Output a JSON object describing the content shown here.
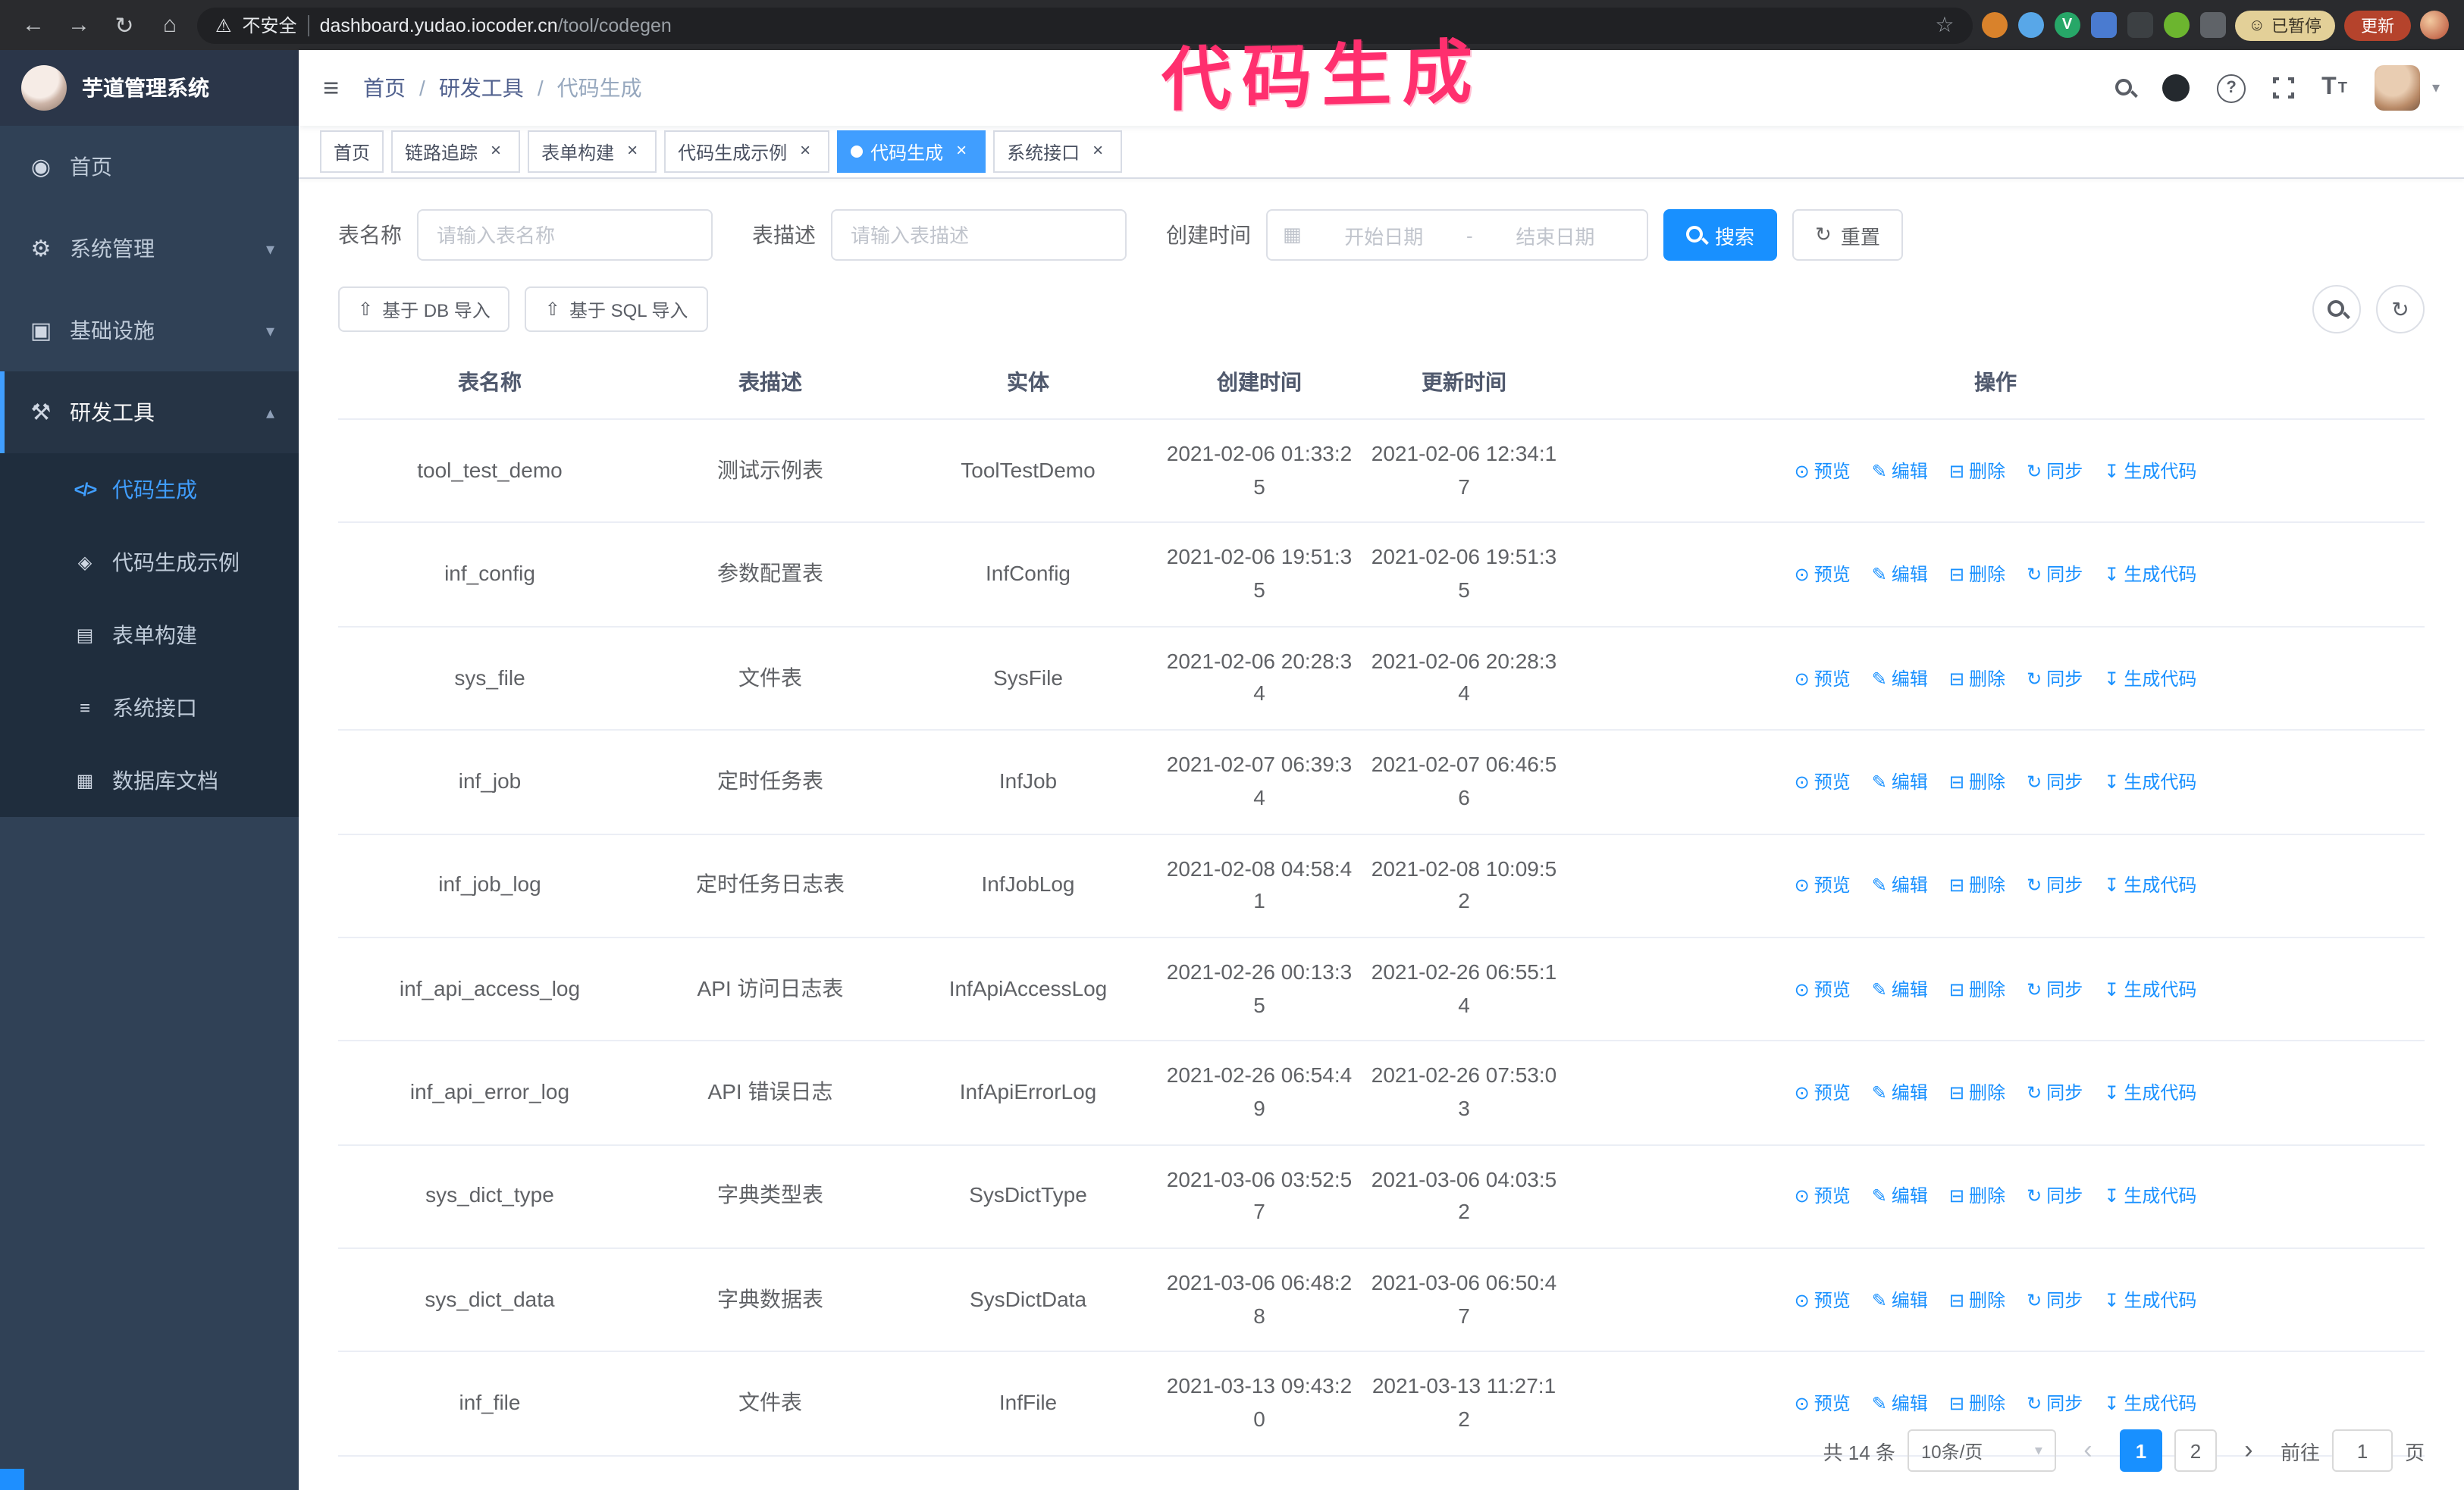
{
  "browser": {
    "security_warning": "不安全",
    "url_host": "dashboard.yudao.iocoder.cn",
    "url_path": "/tool/codegen",
    "paused_emoji": "☺",
    "paused_badge": "已暂停",
    "update_button": "更新",
    "extensions": [
      {
        "name": "orange-extension",
        "color": "#d9822b",
        "round": true
      },
      {
        "name": "blue-drop-extension",
        "color": "#58a7e8",
        "round": true
      },
      {
        "name": "green-verify-extension",
        "color": "#27a768",
        "glyph": "V",
        "round": true
      },
      {
        "name": "people-grid-extension",
        "color": "#4a7bd0",
        "round": false
      },
      {
        "name": "dark-extension",
        "color": "#3c4043",
        "round": false
      },
      {
        "name": "leaf-extension",
        "color": "#6cb52f",
        "round": true
      },
      {
        "name": "puzzle-extension",
        "color": "#5f6368",
        "round": false
      }
    ]
  },
  "annotation": {
    "text": "代码生成"
  },
  "icons": {
    "back": "←",
    "forward": "→",
    "reload": "↻",
    "home": "⌂",
    "warning": "⚠",
    "star": "☆",
    "hamburger": "≡",
    "question": "?",
    "font_size": "T",
    "caret_down": "▾",
    "calendar": "▦",
    "upload": "⇧",
    "refresh": "↻",
    "close": "×"
  },
  "sidebar": {
    "logo_title": "芋道管理系统",
    "menu": [
      {
        "label": "首页",
        "icon": "dashboard-icon",
        "glyph": "◉"
      },
      {
        "label": "系统管理",
        "icon": "gear-icon",
        "glyph": "⚙",
        "arrow": "▾"
      },
      {
        "label": "基础设施",
        "icon": "infrastructure-icon",
        "glyph": "▣",
        "arrow": "▾"
      },
      {
        "label": "研发工具",
        "icon": "tools-icon",
        "glyph": "⚒",
        "arrow": "▴",
        "expanded": true
      }
    ],
    "submenu": [
      {
        "label": "代码生成",
        "icon": "code-icon",
        "glyph": "</>",
        "active": true
      },
      {
        "label": "代码生成示例",
        "icon": "code-example-icon",
        "glyph": "◈"
      },
      {
        "label": "表单构建",
        "icon": "form-builder-icon",
        "glyph": "▤"
      },
      {
        "label": "系统接口",
        "icon": "api-icon",
        "glyph": "≡"
      },
      {
        "label": "数据库文档",
        "icon": "database-doc-icon",
        "glyph": "▦"
      }
    ]
  },
  "header": {
    "breadcrumb": [
      "首页",
      "研发工具",
      "代码生成"
    ],
    "separator": "/"
  },
  "tabs": [
    {
      "label": "首页",
      "closable": false,
      "active": false
    },
    {
      "label": "链路追踪",
      "closable": true,
      "active": false
    },
    {
      "label": "表单构建",
      "closable": true,
      "active": false
    },
    {
      "label": "代码生成示例",
      "closable": true,
      "active": false
    },
    {
      "label": "代码生成",
      "closable": true,
      "active": true
    },
    {
      "label": "系统接口",
      "closable": true,
      "active": false
    }
  ],
  "search": {
    "name_label": "表名称",
    "name_placeholder": "请输入表名称",
    "desc_label": "表描述",
    "desc_placeholder": "请输入表描述",
    "time_label": "创建时间",
    "start_placeholder": "开始日期",
    "separator": "-",
    "end_placeholder": "结束日期",
    "search_button": "搜索",
    "reset_button": "重置"
  },
  "toolbar": {
    "import_db": "基于 DB 导入",
    "import_sql": "基于 SQL 导入"
  },
  "table": {
    "columns": [
      "表名称",
      "表描述",
      "实体",
      "创建时间",
      "更新时间",
      "操作"
    ],
    "actions": [
      {
        "label": "预览",
        "glyph": "⊙",
        "name": "preview"
      },
      {
        "label": "编辑",
        "glyph": "✎",
        "name": "edit"
      },
      {
        "label": "删除",
        "glyph": "⊟",
        "name": "delete"
      },
      {
        "label": "同步",
        "glyph": "↻",
        "name": "sync"
      },
      {
        "label": "生成代码",
        "glyph": "↧",
        "name": "generate-code"
      }
    ],
    "rows": [
      {
        "name": "tool_test_demo",
        "desc": "测试示例表",
        "entity": "ToolTestDemo",
        "create_time": "2021-02-06 01:33:25",
        "update_time": "2021-02-06 12:34:17"
      },
      {
        "name": "inf_config",
        "desc": "参数配置表",
        "entity": "InfConfig",
        "create_time": "2021-02-06 19:51:35",
        "update_time": "2021-02-06 19:51:35"
      },
      {
        "name": "sys_file",
        "desc": "文件表",
        "entity": "SysFile",
        "create_time": "2021-02-06 20:28:34",
        "update_time": "2021-02-06 20:28:34"
      },
      {
        "name": "inf_job",
        "desc": "定时任务表",
        "entity": "InfJob",
        "create_time": "2021-02-07 06:39:34",
        "update_time": "2021-02-07 06:46:56"
      },
      {
        "name": "inf_job_log",
        "desc": "定时任务日志表",
        "entity": "InfJobLog",
        "create_time": "2021-02-08 04:58:41",
        "update_time": "2021-02-08 10:09:52"
      },
      {
        "name": "inf_api_access_log",
        "desc": "API 访问日志表",
        "entity": "InfApiAccessLog",
        "create_time": "2021-02-26 00:13:35",
        "update_time": "2021-02-26 06:55:14"
      },
      {
        "name": "inf_api_error_log",
        "desc": "API 错误日志",
        "entity": "InfApiErrorLog",
        "create_time": "2021-02-26 06:54:49",
        "update_time": "2021-02-26 07:53:03"
      },
      {
        "name": "sys_dict_type",
        "desc": "字典类型表",
        "entity": "SysDictType",
        "create_time": "2021-03-06 03:52:57",
        "update_time": "2021-03-06 04:03:52"
      },
      {
        "name": "sys_dict_data",
        "desc": "字典数据表",
        "entity": "SysDictData",
        "create_time": "2021-03-06 06:48:28",
        "update_time": "2021-03-06 06:50:47"
      },
      {
        "name": "inf_file",
        "desc": "文件表",
        "entity": "InfFile",
        "create_time": "2021-03-13 09:43:20",
        "update_time": "2021-03-13 11:27:12"
      }
    ]
  },
  "pagination": {
    "total": "共 14 条",
    "page_size": "10条/页",
    "pages": [
      "1",
      "2"
    ],
    "active_page": "1",
    "prev": "‹",
    "next": "›",
    "goto_label": "前往",
    "goto_value": "1",
    "goto_suffix": "页"
  },
  "colors": {
    "primary": "#1890ff",
    "menu_active": "#409eff",
    "sidebar_bg": "#304156",
    "submenu_bg": "#1f2d3d",
    "annotation": "#ff2f6e",
    "update_button": "#b5432c"
  }
}
